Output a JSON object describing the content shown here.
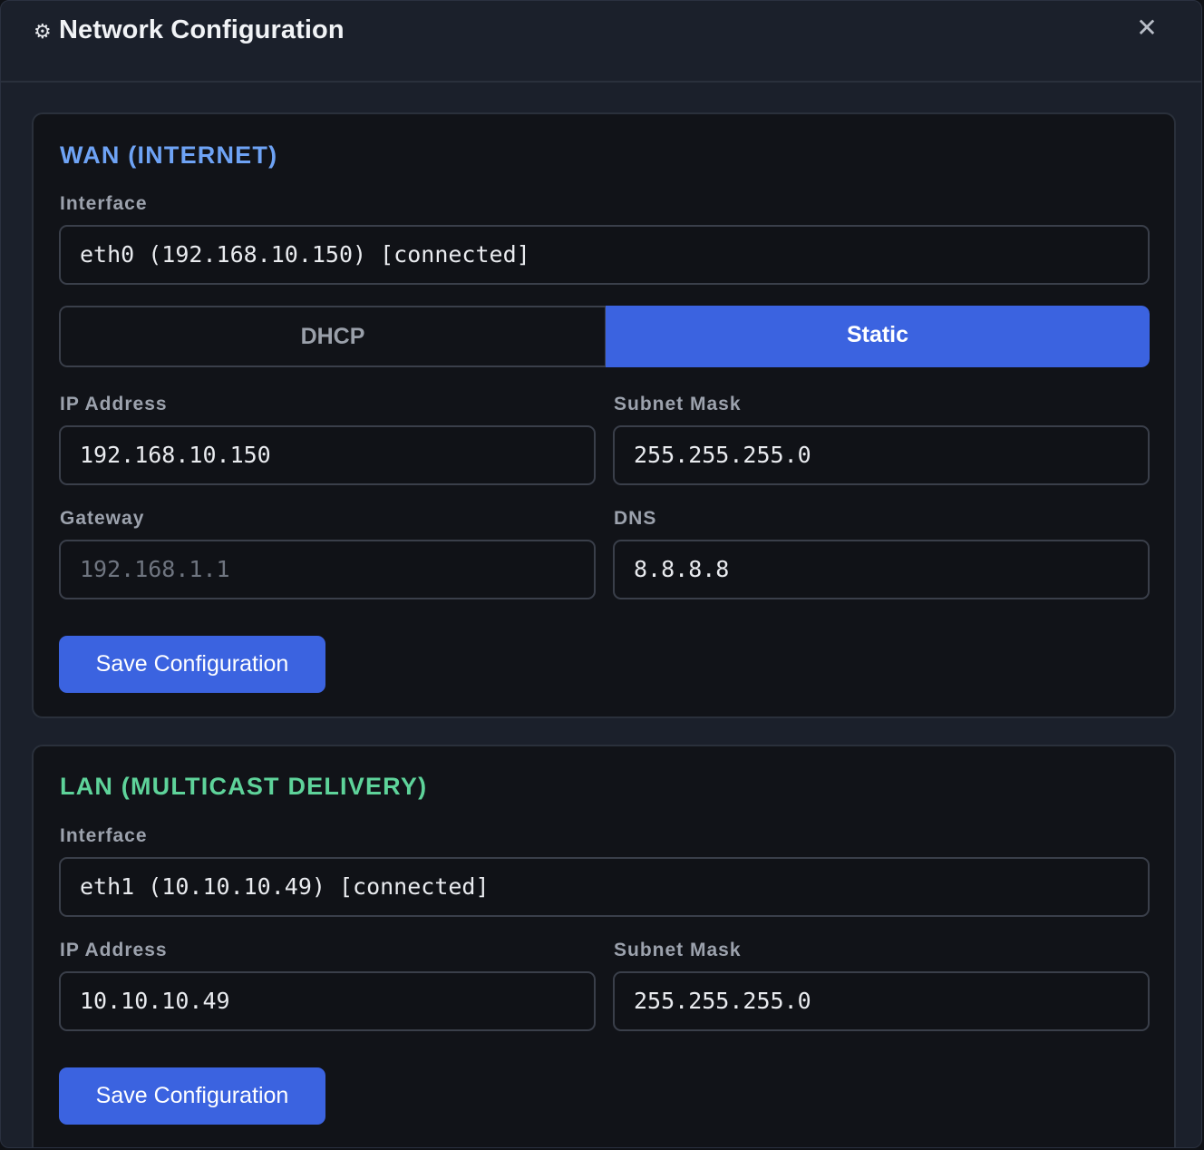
{
  "header": {
    "icon": "gear-icon",
    "title": "Network Configuration",
    "close": "✕"
  },
  "wan": {
    "title": "WAN (INTERNET)",
    "interface_label": "Interface",
    "interface_value": "eth0 (192.168.10.150) [connected]",
    "mode_options": [
      "DHCP",
      "Static"
    ],
    "mode_selected": "Static",
    "ip_label": "IP Address",
    "ip_value": "192.168.10.150",
    "subnet_label": "Subnet Mask",
    "subnet_value": "255.255.255.0",
    "gateway_label": "Gateway",
    "gateway_placeholder": "192.168.1.1",
    "dns_label": "DNS",
    "dns_value": "8.8.8.8",
    "save_label": "Save Configuration"
  },
  "lan": {
    "title": "LAN (MULTICAST DELIVERY)",
    "interface_label": "Interface",
    "interface_value": "eth1 (10.10.10.49) [connected]",
    "ip_label": "IP Address",
    "ip_value": "10.10.10.49",
    "subnet_label": "Subnet Mask",
    "subnet_value": "255.255.255.0",
    "save_label": "Save Configuration"
  },
  "colors": {
    "accent": "#3b63e0",
    "wan_title": "#6ea3f5",
    "lan_title": "#5ed39a",
    "panel": "#1b202b",
    "card": "#111318"
  }
}
